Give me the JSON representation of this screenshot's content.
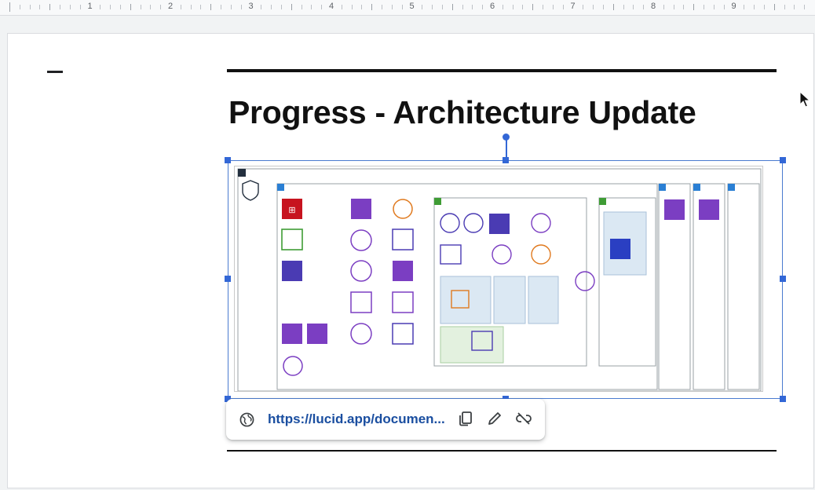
{
  "ruler": {
    "numbers": [
      "1",
      "2",
      "3",
      "4",
      "5",
      "6",
      "7",
      "8",
      "9"
    ]
  },
  "slide": {
    "title": "Progress - Architecture Update"
  },
  "link": {
    "url": "https://lucid.app/documen..."
  },
  "icons": {
    "globe": "globe-icon",
    "copy": "copy-icon",
    "edit": "pencil-icon",
    "unlink": "unlink-icon",
    "cursor": "mouse-pointer-icon"
  },
  "colors": {
    "selection": "#3367d6",
    "link_text": "#1a4ea0",
    "aws_purple": "#7b3ec2",
    "aws_red": "#c7131f",
    "aws_green": "#3f9c35",
    "aws_orange": "#e07a1f"
  }
}
